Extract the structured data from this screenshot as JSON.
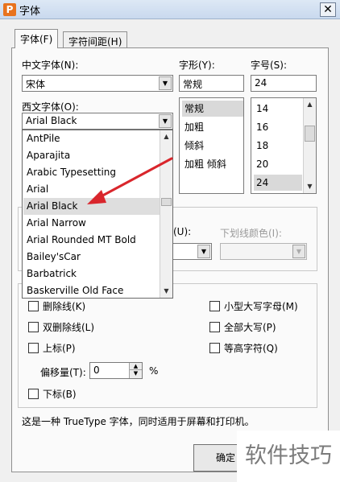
{
  "window": {
    "title": "字体",
    "close_glyph": "✕",
    "app_icon_glyph": "P"
  },
  "tabs": [
    {
      "label": "字体(F)"
    },
    {
      "label": "字符间距(H)"
    }
  ],
  "chinese_font": {
    "label": "中文字体(N):",
    "value": "宋体"
  },
  "style": {
    "label": "字形(Y):",
    "value": "常规",
    "options": [
      "常规",
      "加粗",
      "倾斜",
      "加粗 倾斜"
    ],
    "selected": "常规"
  },
  "size": {
    "label": "字号(S):",
    "value": "24",
    "options": [
      "14",
      "16",
      "18",
      "20",
      "24"
    ],
    "selected": "24"
  },
  "western_font": {
    "label": "西文字体(O):",
    "value": "Arial Black",
    "options": [
      "AntPile",
      "Aparajita",
      "Arabic Typesetting",
      "Arial",
      "Arial Black",
      "Arial Narrow",
      "Arial Rounded MT Bold",
      "Bailey'sCar",
      "Barbatrick",
      "Baskerville Old Face"
    ],
    "highlighted": "Arial Black"
  },
  "underline": {
    "style_label_suffix": "(U):",
    "color_label": "下划线颜色(I):"
  },
  "effects": {
    "strikethrough": "删除线(K)",
    "double_strikethrough": "双删除线(L)",
    "superscript": "上标(P)",
    "offset_label": "偏移量(T):",
    "offset_value": "0",
    "offset_unit": "%",
    "subscript": "下标(B)",
    "small_caps": "小型大写字母(M)",
    "all_caps": "全部大写(P)",
    "equal_height": "等高字符(Q)"
  },
  "description": "这是一种 TrueType 字体，同时适用于屏幕和打印机。",
  "buttons": {
    "ok": "确定"
  },
  "watermark": "软件技巧",
  "colors": {
    "arrow": "#d9262c",
    "titlebar": "#c9d9ee",
    "app_icon": "#e8731e"
  }
}
